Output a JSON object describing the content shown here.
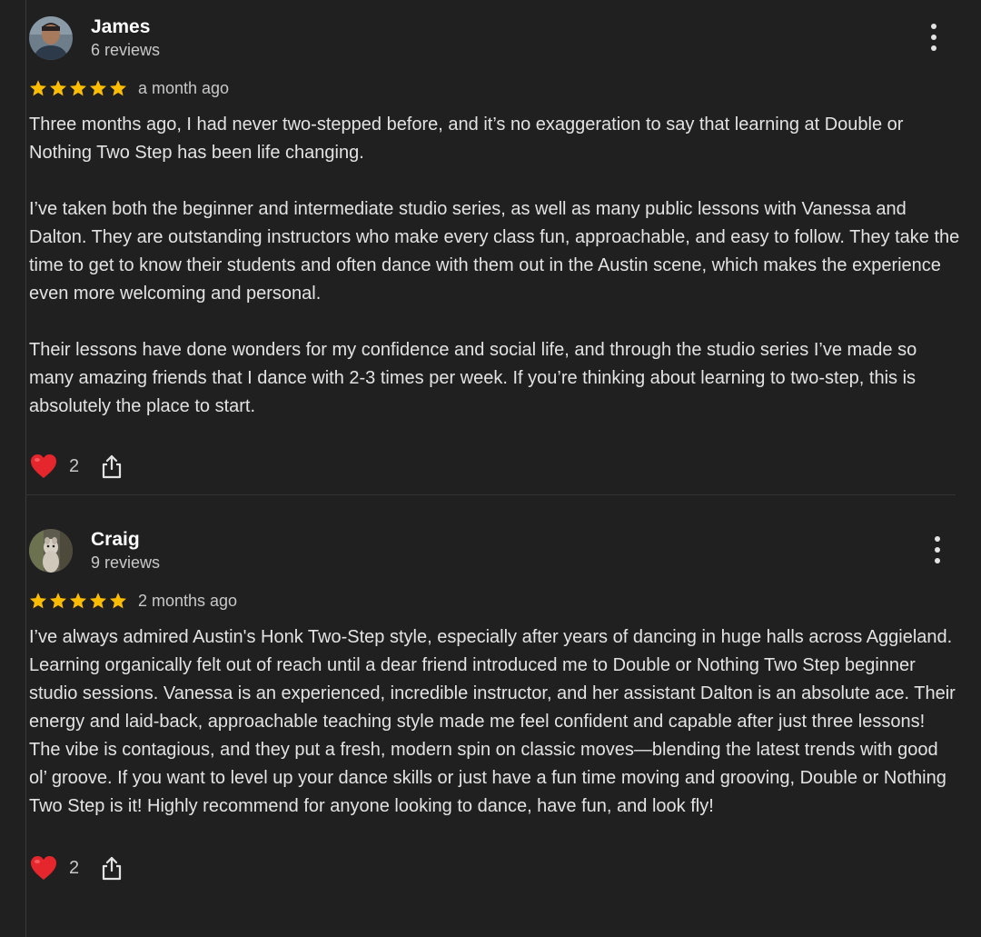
{
  "reviews": [
    {
      "author": "James",
      "review_count": "6 reviews",
      "rating": 5,
      "date": "a month ago",
      "paragraphs": [
        "Three months ago, I had never two-stepped before, and it’s no exaggeration to say that learning at Double or Nothing Two Step has been life changing.",
        "I’ve taken both the beginner and intermediate studio series, as well as many public lessons with Vanessa and Dalton. They are outstanding instructors who make every class fun, approachable, and easy to follow. They take the time to get to know their students and often dance with them out in the Austin scene, which makes the experience even more welcoming and personal.",
        "Their lessons have done wonders for my confidence and social life, and through the studio series I’ve made so many amazing friends that I dance with 2-3 times per week. If you’re thinking about learning to two-step, this is absolutely the place to start."
      ],
      "likes": "2",
      "icons": [
        "avatar-photo",
        "more-vert-icon",
        "star-icon",
        "heart-icon",
        "share-icon"
      ]
    },
    {
      "author": "Craig",
      "review_count": "9 reviews",
      "rating": 5,
      "date": "2 months ago",
      "paragraphs": [
        "I’ve always admired Austin's Honk Two-Step style, especially after years of dancing in huge halls across Aggieland. Learning organically felt out of reach until a dear friend introduced me to Double or Nothing Two Step beginner studio sessions. Vanessa is an experienced, incredible instructor, and her assistant Dalton is an absolute ace. Their energy and laid-back, approachable teaching style made me feel confident and capable after just three lessons! The vibe is contagious, and they put a fresh, modern spin on classic moves—blending the latest trends with good ol’ groove. If you want to level up your dance skills or just have a fun time moving and grooving, Double or Nothing Two Step is it! Highly recommend for anyone looking to dance, have fun, and look fly!"
      ],
      "likes": "2",
      "icons": [
        "avatar-photo",
        "more-vert-icon",
        "star-icon",
        "heart-icon",
        "share-icon"
      ]
    }
  ],
  "colors": {
    "background": "#202020",
    "text": "#e3e3e3",
    "secondary_text": "#c8c8c8",
    "star": "#fbbc04",
    "heart": "#e5262c"
  }
}
